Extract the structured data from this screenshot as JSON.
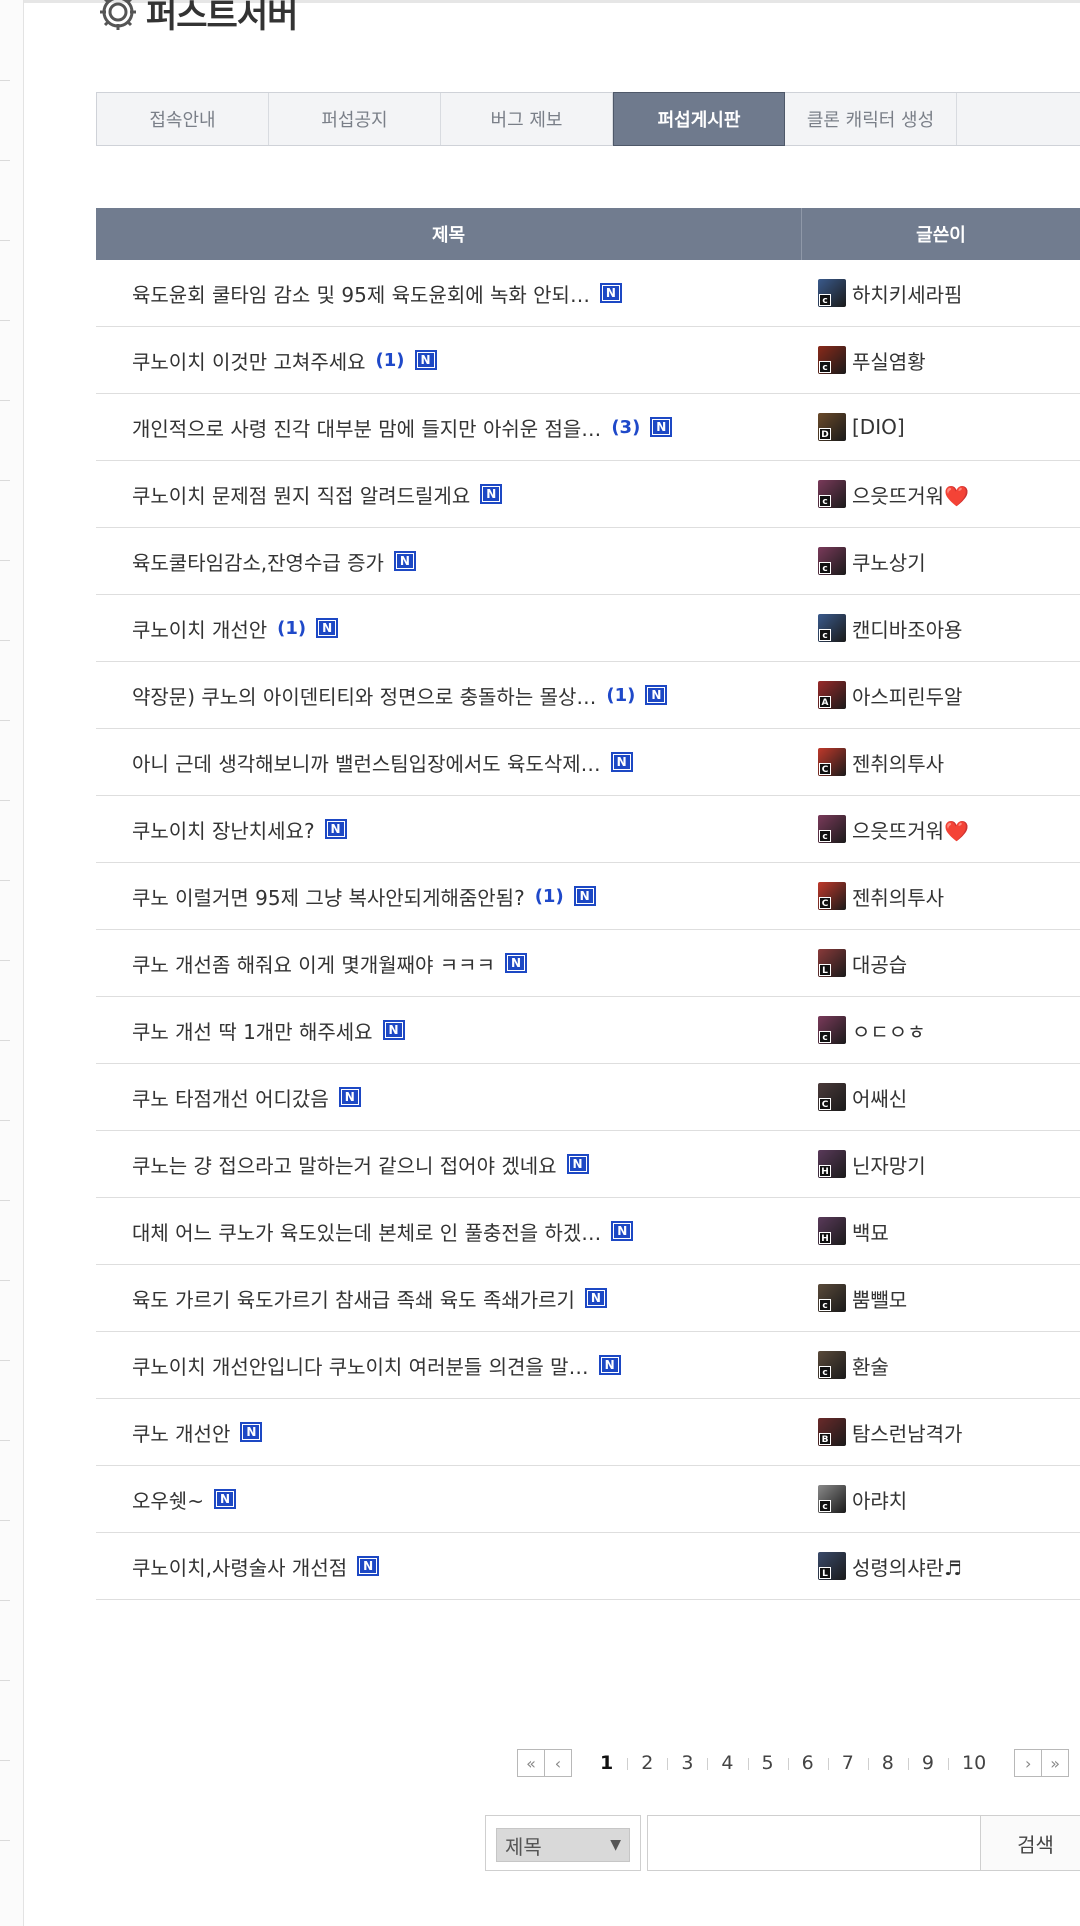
{
  "page": {
    "title": "퍼스트서버"
  },
  "tabs": [
    {
      "label": "접속안내",
      "active": false
    },
    {
      "label": "퍼섭공지",
      "active": false
    },
    {
      "label": "버그 제보",
      "active": false
    },
    {
      "label": "퍼섭게시판",
      "active": true
    },
    {
      "label": "클론 캐릭터 생성",
      "active": false
    }
  ],
  "board": {
    "columns": {
      "title": "제목",
      "writer": "글쓴이"
    },
    "new_badge": "N",
    "rows": [
      {
        "title": "육도윤회 쿨타임 감소 및 95제 육도윤회에 녹화 안되…",
        "comments": "",
        "writer": "하치키세라핌",
        "level": "c",
        "avatar_color": "#3a5a8c"
      },
      {
        "title": "쿠노이치 이것만 고쳐주세요",
        "comments": "(1)",
        "writer": "푸실염황",
        "level": "c",
        "avatar_color": "#8a2a1a"
      },
      {
        "title": "개인적으로 사령 진각 대부분 맘에 들지만 아쉬운 점을…",
        "comments": "(3)",
        "writer": "[DIO]",
        "level": "D",
        "avatar_color": "#6a4a2a"
      },
      {
        "title": "쿠노이치 문제점 뭔지 직접 알려드릴게요",
        "comments": "",
        "writer": "으읏뜨거워❤️",
        "level": "c",
        "avatar_color": "#7a3a5a"
      },
      {
        "title": "육도쿨타임감소,잔영수급 증가",
        "comments": "",
        "writer": "쿠노상기",
        "level": "c",
        "avatar_color": "#7a3a5a"
      },
      {
        "title": "쿠노이치 개선안",
        "comments": "(1)",
        "writer": "캔디바조아용",
        "level": "c",
        "avatar_color": "#3a5a8c"
      },
      {
        "title": "약장문) 쿠노의 아이덴티티와 정면으로 충돌하는 몰상…",
        "comments": "(1)",
        "writer": "아스피린두알",
        "level": "A",
        "avatar_color": "#9a2a2a"
      },
      {
        "title": "아니 근데 생각해보니까 밸런스팀입장에서도 육도삭제…",
        "comments": "",
        "writer": "젠취의투사",
        "level": "C",
        "avatar_color": "#c0392b"
      },
      {
        "title": "쿠노이치 장난치세요?",
        "comments": "",
        "writer": "으읏뜨거워❤️",
        "level": "c",
        "avatar_color": "#7a3a5a"
      },
      {
        "title": "쿠노 이럴거면 95제 그냥 복사안되게해줌안됨?",
        "comments": "(1)",
        "writer": "젠취의투사",
        "level": "C",
        "avatar_color": "#c0392b"
      },
      {
        "title": "쿠노 개선좀 해줘요 이게 몇개월째야 ㅋㅋㅋ",
        "comments": "",
        "writer": "대공습",
        "level": "L",
        "avatar_color": "#8a3a3a"
      },
      {
        "title": "쿠노 개선 딱 1개만 해주세요",
        "comments": "",
        "writer": "ㅇㄷㅇㅎ",
        "level": "c",
        "avatar_color": "#7a3a5a"
      },
      {
        "title": "쿠노 타점개선 어디갔음",
        "comments": "",
        "writer": "어쌔신",
        "level": "C",
        "avatar_color": "#4a3a3a"
      },
      {
        "title": "쿠노는 걍 접으라고 말하는거 같으니 접어야 겠네요",
        "comments": "",
        "writer": "닌자망기",
        "level": "H",
        "avatar_color": "#5a3a5a"
      },
      {
        "title": "대체 어느 쿠노가 육도있는데 본체로 인 풀충전을 하겠…",
        "comments": "",
        "writer": "백묘",
        "level": "H",
        "avatar_color": "#5a3a5a"
      },
      {
        "title": "육도 가르기 육도가르기 참새급 족쇄 육도 족쇄가르기",
        "comments": "",
        "writer": "뿜뺄모",
        "level": "c",
        "avatar_color": "#5a4a3a"
      },
      {
        "title": "쿠노이치 개선안입니다 쿠노이치 여러분들 의견을 말…",
        "comments": "",
        "writer": "환술",
        "level": "c",
        "avatar_color": "#5a4a3a"
      },
      {
        "title": "쿠노 개선안",
        "comments": "",
        "writer": "탐스런남격가",
        "level": "B",
        "avatar_color": "#6a2a2a"
      },
      {
        "title": "오우쉣~",
        "comments": "",
        "writer": "아랴치",
        "level": "c",
        "avatar_color": "#8a8a8a"
      },
      {
        "title": "쿠노이치,사령술사 개선점",
        "comments": "",
        "writer": "성령의샤란♬",
        "level": "L",
        "avatar_color": "#3a4a6a"
      }
    ]
  },
  "pagination": {
    "first": "«",
    "prev": "‹",
    "pages": [
      "1",
      "2",
      "3",
      "4",
      "5",
      "6",
      "7",
      "8",
      "9",
      "10"
    ],
    "current": "1",
    "next": "›",
    "last": "»"
  },
  "search": {
    "field_selected": "제목",
    "input_value": "",
    "button_label": "검색"
  },
  "icons": {
    "title_icon": "gear-icon",
    "select_arrow": "triangle-down-icon"
  },
  "colors": {
    "header_bar": "#717c8f",
    "active_tab": "#6f7a8d",
    "new_badge": "#1d48c4",
    "comment_count": "#1f49c9"
  }
}
